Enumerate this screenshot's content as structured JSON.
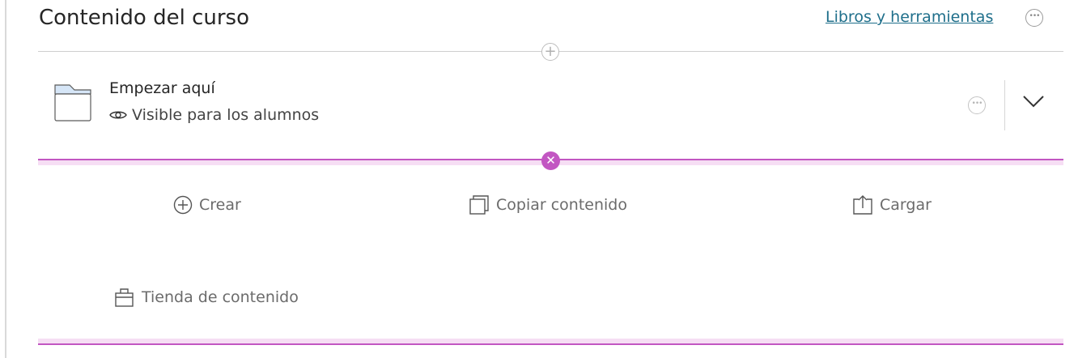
{
  "header": {
    "title": "Contenido del curso",
    "books_link": "Libros y herramientas"
  },
  "item": {
    "title": "Empezar aquí",
    "visibility": "Visible para los alumnos"
  },
  "actions": {
    "create": "Crear",
    "copy": "Copiar contenido",
    "upload": "Cargar",
    "store": "Tienda de contenido"
  },
  "colors": {
    "accent_purple": "#c256c2",
    "link": "#1f6f8b",
    "folder_tab": "#d6e6f7"
  },
  "icons": [
    "more-options-icon",
    "add-icon",
    "folder-icon",
    "eye-icon",
    "chevron-down-icon",
    "close-icon",
    "plus-circle-icon",
    "copy-icon",
    "upload-icon",
    "store-icon"
  ]
}
